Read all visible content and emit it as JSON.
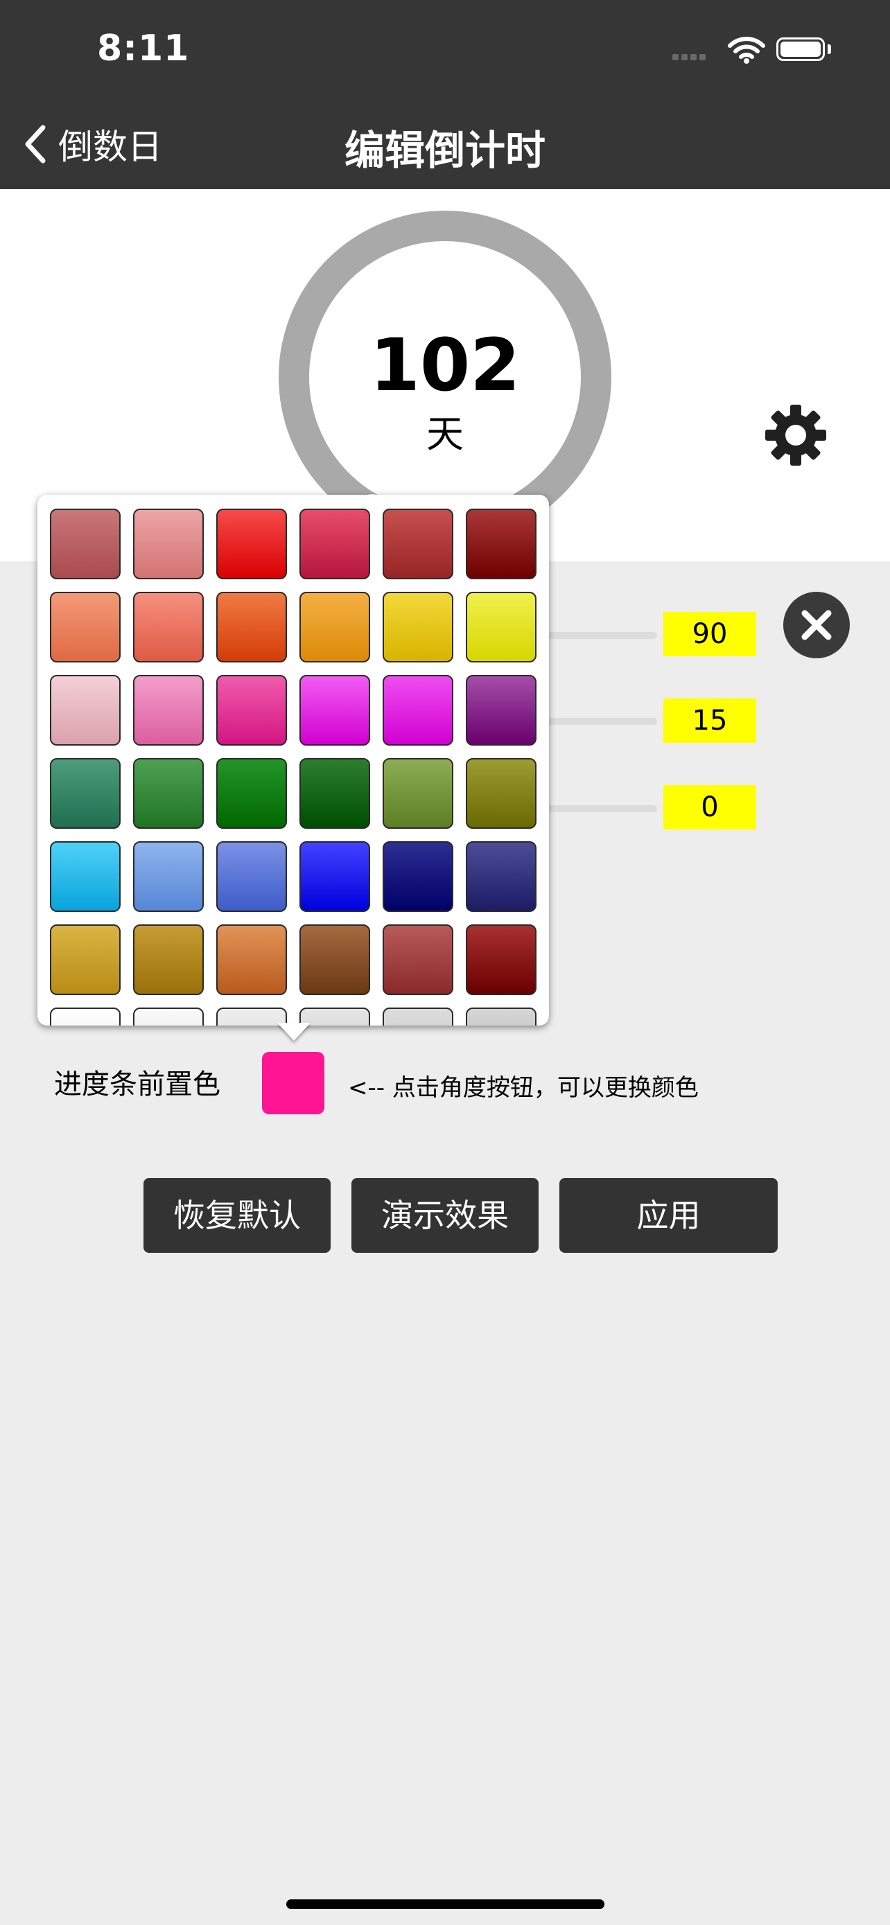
{
  "status_bar": {
    "time": "8:11"
  },
  "nav": {
    "back_label": "倒数日",
    "title": "编辑倒计时"
  },
  "countdown": {
    "number": "102",
    "unit": "天",
    "progress_fraction": 0.08,
    "progress_color": "#ff1493",
    "ring_color": "#a9a9a9"
  },
  "sliders": [
    {
      "value": "90"
    },
    {
      "value": "15"
    },
    {
      "value": "0"
    }
  ],
  "palette": {
    "rows": [
      [
        [
          "#c9777a",
          "#a94a4e"
        ],
        [
          "#eda5a6",
          "#d27373"
        ],
        [
          "#f64b4b",
          "#d90000"
        ],
        [
          "#e84d6c",
          "#b5163c"
        ],
        [
          "#c6504f",
          "#962525"
        ],
        [
          "#ab3737",
          "#6e0000"
        ]
      ],
      [
        [
          "#f49a78",
          "#df6a44"
        ],
        [
          "#f5907e",
          "#df5a45"
        ],
        [
          "#f07a44",
          "#d43c08"
        ],
        [
          "#f4b044",
          "#dd8a08"
        ],
        [
          "#f2d83a",
          "#d8b400"
        ],
        [
          "#f0f04e",
          "#d6d600"
        ]
      ],
      [
        [
          "#f4cfd6",
          "#dba1ad"
        ],
        [
          "#f39dcb",
          "#dc5e9f"
        ],
        [
          "#f05cac",
          "#d41583"
        ],
        [
          "#f25cf2",
          "#d200d2"
        ],
        [
          "#ef4df0",
          "#d200d2"
        ],
        [
          "#a44ea8",
          "#6a006e"
        ]
      ],
      [
        [
          "#4d9d7c",
          "#1f7050"
        ],
        [
          "#4ea152",
          "#1f7424"
        ],
        [
          "#239528",
          "#006800"
        ],
        [
          "#2c7f2e",
          "#004e00"
        ],
        [
          "#8eae55",
          "#5e7e25"
        ],
        [
          "#9c9c32",
          "#6a6a02"
        ]
      ],
      [
        [
          "#4fd2f7",
          "#08a3dc"
        ],
        [
          "#8fb4ee",
          "#5686d6"
        ],
        [
          "#7b92e6",
          "#3f5cc8"
        ],
        [
          "#4242ff",
          "#0000dc"
        ],
        [
          "#2d2e92",
          "#000068"
        ],
        [
          "#4c4c98",
          "#1c1c66"
        ]
      ],
      [
        [
          "#dab445",
          "#b88c16"
        ],
        [
          "#c79c35",
          "#9a700a"
        ],
        [
          "#e29358",
          "#b85a1e"
        ],
        [
          "#a66a40",
          "#6a3814"
        ],
        [
          "#b95a5a",
          "#8a2a2a"
        ],
        [
          "#a83030",
          "#6a0000"
        ]
      ],
      [
        [
          "#ffffff",
          "#e6e6e6"
        ],
        [
          "#fafafa",
          "#e0e0e0"
        ],
        [
          "#eeeeee",
          "#d0d0d0"
        ],
        [
          "#e6e6e6",
          "#c6c6c6"
        ],
        [
          "#dddddd",
          "#bcbcbc"
        ],
        [
          "#d6d6d6",
          "#b0b0b0"
        ]
      ]
    ]
  },
  "color_setting": {
    "label": "进度条前置色",
    "current_color": "#ff1493",
    "hint": "<-- 点击角度按钮，可以更换颜色"
  },
  "buttons": {
    "reset": "恢复默认",
    "demo": "演示效果",
    "apply": "应用"
  }
}
